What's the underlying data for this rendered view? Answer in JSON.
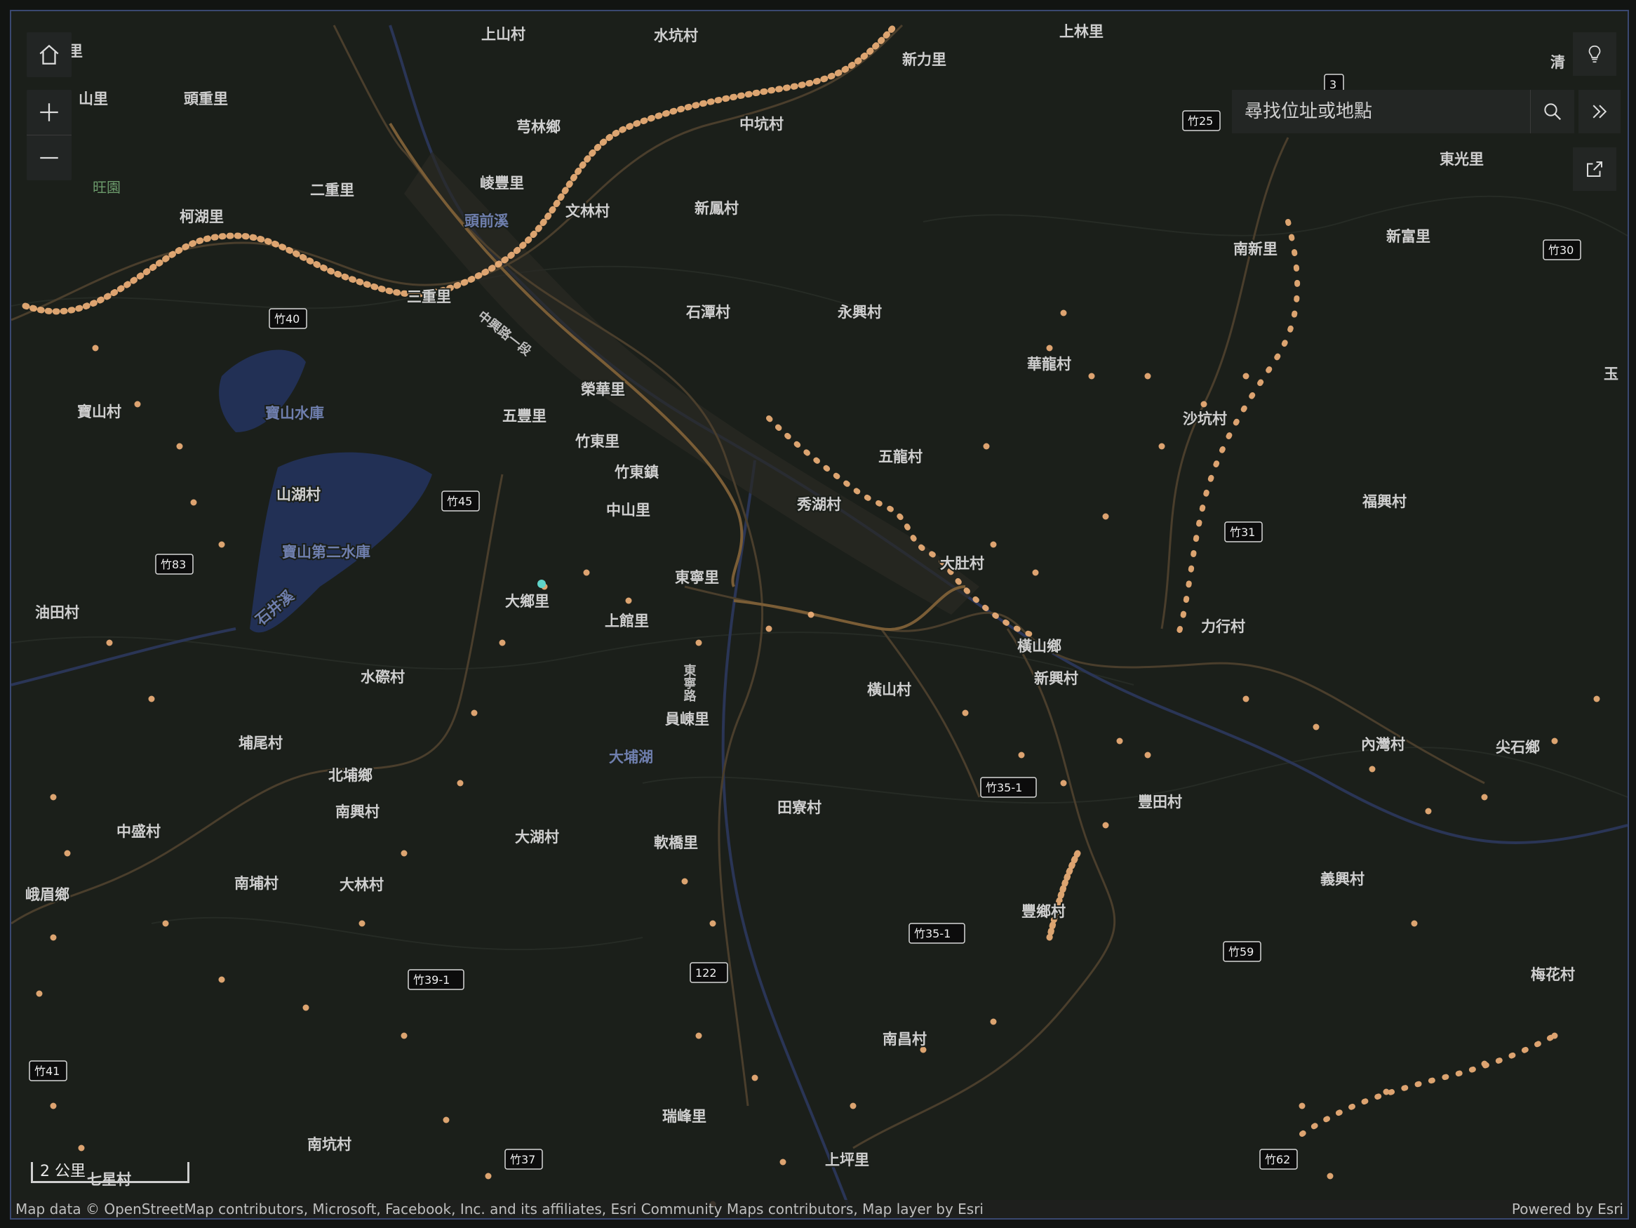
{
  "map": {
    "places": [
      {
        "id": "p1",
        "name": "上山村"
      },
      {
        "id": "p2",
        "name": "水坑村"
      },
      {
        "id": "p3",
        "name": "新力里"
      },
      {
        "id": "p4",
        "name": "上林里"
      },
      {
        "id": "p5",
        "name": "頭重里"
      },
      {
        "id": "p6",
        "name": "芎林鄉"
      },
      {
        "id": "p7",
        "name": "中坑村"
      },
      {
        "id": "p8",
        "name": "二重里"
      },
      {
        "id": "p9",
        "name": "東光里"
      },
      {
        "id": "p10",
        "name": "柯湖里"
      },
      {
        "id": "p11",
        "name": "崚豐里"
      },
      {
        "id": "p12",
        "name": "文林村"
      },
      {
        "id": "p13",
        "name": "新鳳村"
      },
      {
        "id": "p14",
        "name": "新富里"
      },
      {
        "id": "p15",
        "name": "南新里"
      },
      {
        "id": "p16",
        "name": "三重里"
      },
      {
        "id": "p17",
        "name": "石潭村"
      },
      {
        "id": "p18",
        "name": "永興村"
      },
      {
        "id": "p19",
        "name": "華龍村"
      },
      {
        "id": "p20",
        "name": "榮華里"
      },
      {
        "id": "p21",
        "name": "寶山村"
      },
      {
        "id": "p22",
        "name": "五豐里"
      },
      {
        "id": "p23",
        "name": "沙坑村"
      },
      {
        "id": "p24",
        "name": "竹東里"
      },
      {
        "id": "p25",
        "name": "五龍村"
      },
      {
        "id": "p26",
        "name": "竹東鎮"
      },
      {
        "id": "p27",
        "name": "山湖村"
      },
      {
        "id": "p28",
        "name": "中山里"
      },
      {
        "id": "p29",
        "name": "秀湖村"
      },
      {
        "id": "p30",
        "name": "福興村"
      },
      {
        "id": "p31",
        "name": "大肚村"
      },
      {
        "id": "p32",
        "name": "東寧里"
      },
      {
        "id": "p33",
        "name": "大鄉里"
      },
      {
        "id": "p34",
        "name": "上館里"
      },
      {
        "id": "p35",
        "name": "油田村"
      },
      {
        "id": "p36",
        "name": "力行村"
      },
      {
        "id": "p37",
        "name": "橫山鄉"
      },
      {
        "id": "p38",
        "name": "新興村"
      },
      {
        "id": "p39",
        "name": "水磜村"
      },
      {
        "id": "p40",
        "name": "橫山村"
      },
      {
        "id": "p41",
        "name": "員崠里"
      },
      {
        "id": "p42",
        "name": "埔尾村"
      },
      {
        "id": "p43",
        "name": "內灣村"
      },
      {
        "id": "p44",
        "name": "尖石鄉"
      },
      {
        "id": "p45",
        "name": "北埔鄉"
      },
      {
        "id": "p46",
        "name": "南興村"
      },
      {
        "id": "p47",
        "name": "田寮村"
      },
      {
        "id": "p48",
        "name": "豐田村"
      },
      {
        "id": "p49",
        "name": "中盛村"
      },
      {
        "id": "p50",
        "name": "大湖村"
      },
      {
        "id": "p51",
        "name": "軟橋里"
      },
      {
        "id": "p52",
        "name": "南埔村"
      },
      {
        "id": "p53",
        "name": "大林村"
      },
      {
        "id": "p54",
        "name": "峨眉鄉"
      },
      {
        "id": "p55",
        "name": "義興村"
      },
      {
        "id": "p56",
        "name": "豐鄉村"
      },
      {
        "id": "p57",
        "name": "梅花村"
      },
      {
        "id": "p58",
        "name": "南昌村"
      },
      {
        "id": "p59",
        "name": "瑞峰里"
      },
      {
        "id": "p60",
        "name": "南坑村"
      },
      {
        "id": "p61",
        "name": "上坪里"
      },
      {
        "id": "p62",
        "name": "七星村"
      },
      {
        "id": "p63",
        "name": "東里"
      },
      {
        "id": "p64",
        "name": "山里"
      },
      {
        "id": "p65",
        "name": "清"
      },
      {
        "id": "p66",
        "name": "玉"
      }
    ],
    "water_labels": [
      {
        "id": "w1",
        "name": "頭前溪"
      },
      {
        "id": "w2",
        "name": "寶山水庫"
      },
      {
        "id": "w3",
        "name": "寶山第二水庫"
      },
      {
        "id": "w4",
        "name": "石井溪"
      },
      {
        "id": "w5",
        "name": "大埔湖"
      }
    ],
    "park_labels": [
      {
        "id": "g1",
        "name": "旺園"
      }
    ],
    "road_labels": [
      {
        "id": "r1",
        "name": "中興路一段"
      },
      {
        "id": "r2",
        "name": "東寧路"
      }
    ],
    "route_shields": [
      {
        "id": "s1",
        "label": "竹40"
      },
      {
        "id": "s2",
        "label": "竹45"
      },
      {
        "id": "s3",
        "label": "竹83"
      },
      {
        "id": "s4",
        "label": "竹25"
      },
      {
        "id": "s5",
        "label": "竹30"
      },
      {
        "id": "s6",
        "label": "竹31"
      },
      {
        "id": "s7",
        "label": "竹35-1"
      },
      {
        "id": "s8",
        "label": "竹35-1"
      },
      {
        "id": "s9",
        "label": "122"
      },
      {
        "id": "s10",
        "label": "竹39-1"
      },
      {
        "id": "s11",
        "label": "竹59"
      },
      {
        "id": "s12",
        "label": "竹41"
      },
      {
        "id": "s13",
        "label": "竹37"
      },
      {
        "id": "s14",
        "label": "竹62"
      },
      {
        "id": "s15",
        "label": "3"
      }
    ],
    "colors": {
      "background": "#1b1f1a",
      "road": "#4a3e2c",
      "highway": "#7a5d36",
      "river": "#2a3556",
      "reservoir": "#223055",
      "point": "#f2b27a",
      "selected": "#5fd3c9"
    }
  },
  "controls": {
    "home_icon": "home-icon",
    "zoom_in_icon": "plus-icon",
    "zoom_out_icon": "minus-icon",
    "lightbulb_icon": "lightbulb-icon",
    "search_icon": "search-icon",
    "expand_icon": "double-chevron-right-icon",
    "share_icon": "share-icon"
  },
  "search": {
    "placeholder": "尋找位址或地點"
  },
  "scale": {
    "label": "2 公里"
  },
  "attribution": {
    "text": "Map data © OpenStreetMap contributors, Microsoft, Facebook, Inc. and its affiliates, Esri Community Maps contributors, Map layer by Esri",
    "powered": "Powered by Esri"
  }
}
